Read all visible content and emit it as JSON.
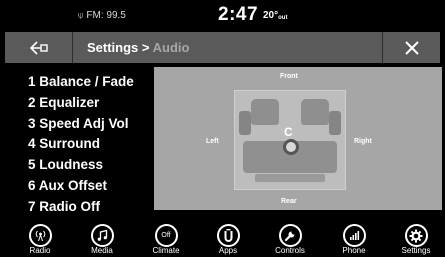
{
  "status": {
    "radio": "FM: 99.5",
    "clock": "2:47",
    "temp_value": "20°",
    "temp_suffix": "out"
  },
  "titlebar": {
    "crumb": "Settings >",
    "current": "Audio"
  },
  "menu": [
    {
      "label": "1 Balance / Fade"
    },
    {
      "label": "2 Equalizer"
    },
    {
      "label": "3 Speed Adj Vol"
    },
    {
      "label": "4 Surround"
    },
    {
      "label": "5 Loudness"
    },
    {
      "label": "6 Aux Offset"
    },
    {
      "label": "7 Radio Off"
    }
  ],
  "balance": {
    "front": "Front",
    "rear": "Rear",
    "left": "Left",
    "right": "Right",
    "center": "C"
  },
  "nav": [
    {
      "label": "Radio",
      "icon": "radio-icon"
    },
    {
      "label": "Media",
      "icon": "media-icon"
    },
    {
      "label": "Climate",
      "icon": "climate-icon",
      "glyph": "Off"
    },
    {
      "label": "Apps",
      "icon": "apps-icon"
    },
    {
      "label": "Controls",
      "icon": "controls-icon"
    },
    {
      "label": "Phone",
      "icon": "phone-icon"
    },
    {
      "label": "Settings",
      "icon": "settings-icon"
    }
  ],
  "colors": {
    "background": "#000000",
    "titlebar": "#5a5a5a",
    "panel": "#a6a6a6",
    "breadcrumb_current": "#a7a7a7"
  }
}
